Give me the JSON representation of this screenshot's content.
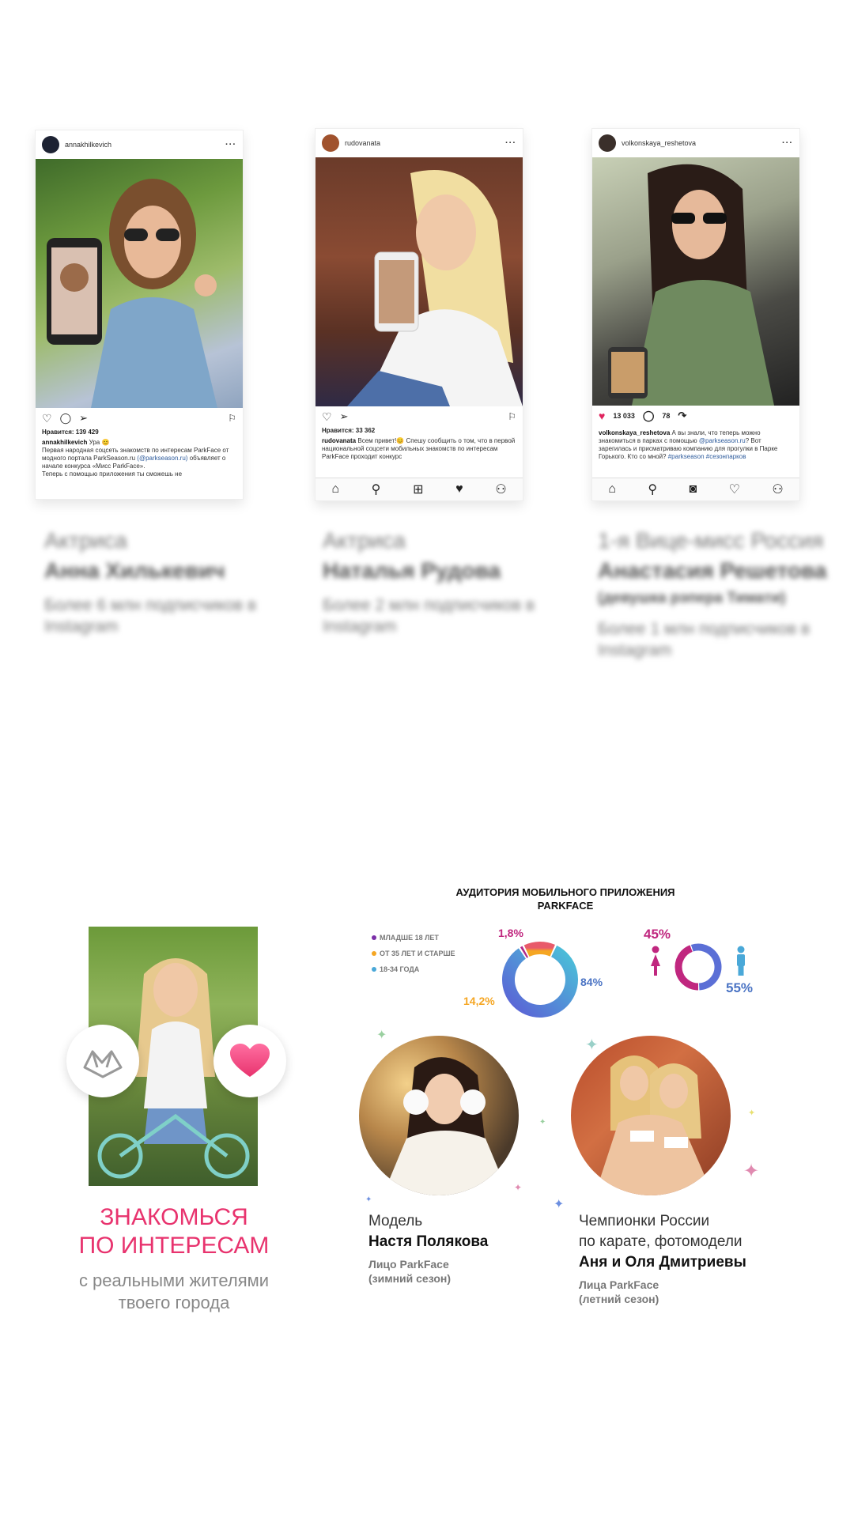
{
  "posts": [
    {
      "username": "annakhilkevich",
      "likes": "Нравится: 139 429",
      "caption_user": "annakhilkevich",
      "caption_text": "Ура 😊",
      "caption_more": "Первая народная соцсеть знакомств по интересам ParkFace от модного портала ParkSeason.ru",
      "caption_link": "(@parkseason.ru)",
      "caption_tail": "объявляет о начале конкурса «Мисс ParkFace».",
      "caption_last": "Теперь с помощью приложения ты сможешь не",
      "role": "Актриса",
      "name": "Анна Хилькевич",
      "subs": "Более 6 млн подписчиков в Instagram"
    },
    {
      "username": "rudovanata",
      "likes": "Нравится: 33 362",
      "caption_user": "rudovanata",
      "caption_text": "Всем привет!😊 Спешу сообщить о том, что в первой национальной соцсети мобильных знакомств по интересам ParkFace проходит конкурс",
      "role": "Актриса",
      "name": "Наталья Рудова",
      "subs": "Более 2 млн подписчиков в Instagram"
    },
    {
      "username": "volkonskaya_reshetova",
      "likes_count": "13 033",
      "comments_count": "78",
      "caption_user": "volkonskaya_reshetova",
      "caption_text": "А вы знали, что теперь можно знакомиться в парках с помощью",
      "caption_link": "@parkseason.ru",
      "caption_tail": "? Вот зарегилась и присматриваю компанию для прогулки в Парке Горького. Кто со мной?",
      "caption_tags": "#parkseason #сезонпарков",
      "role": "1-я Вице-мисс Россия",
      "name": "Анастасия Решетова",
      "extra": "(девушка рэпера Тимати)",
      "subs": "Более 1 млн подписчиков в Instagram"
    }
  ],
  "promo": {
    "title_line1": "ЗНАКОМЬСЯ",
    "title_line2": "ПО ИНТЕРЕСАМ",
    "sub_line1": "с реальными жителями",
    "sub_line2": "твоего города"
  },
  "audience": {
    "title_line1": "АУДИТОРИЯ МОБИЛЬНОГО ПРИЛОЖЕНИЯ",
    "title_line2": "PARKFACE",
    "legend": [
      {
        "label": "МЛАДШЕ 18 ЛЕТ",
        "color": "#7b2fa8"
      },
      {
        "label": "ОТ 35 ЛЕТ И СТАРШЕ",
        "color": "#f5a623"
      },
      {
        "label": "18-34 ГОДА",
        "color": "#4aa8d8"
      }
    ],
    "age_labels": {
      "under18": "1,8%",
      "over35": "14,2%",
      "age18_34": "84%"
    },
    "gender_labels": {
      "female": "45%",
      "male": "55%"
    }
  },
  "chart_data": [
    {
      "type": "pie",
      "title": "АУДИТОРИЯ МОБИЛЬНОГО ПРИЛОЖЕНИЯ PARKFACE",
      "categories": [
        "МЛАДШЕ 18 ЛЕТ",
        "ОТ 35 ЛЕТ И СТАРШЕ",
        "18-34 ГОДА"
      ],
      "values": [
        1.8,
        14.2,
        84
      ],
      "colors": [
        "#b0288a",
        "#f5a623",
        "#4f7fd8"
      ],
      "legend": "left"
    },
    {
      "type": "pie",
      "title": "",
      "categories": [
        "female",
        "male"
      ],
      "values": [
        45,
        55
      ],
      "colors": [
        "#c0277f",
        "#4aa8d8"
      ]
    }
  ],
  "faces": [
    {
      "role": "Модель",
      "name": "Настя Полякова",
      "face_line1": "Лицо ParkFace",
      "face_line2": "(зимний сезон)"
    },
    {
      "role_line1": "Чемпионки России",
      "role_line2": "по карате, фотомодели",
      "name": "Аня и Оля Дмитриевы",
      "face_line1": "Лица ParkFace",
      "face_line2": "(летний сезон)"
    }
  ]
}
